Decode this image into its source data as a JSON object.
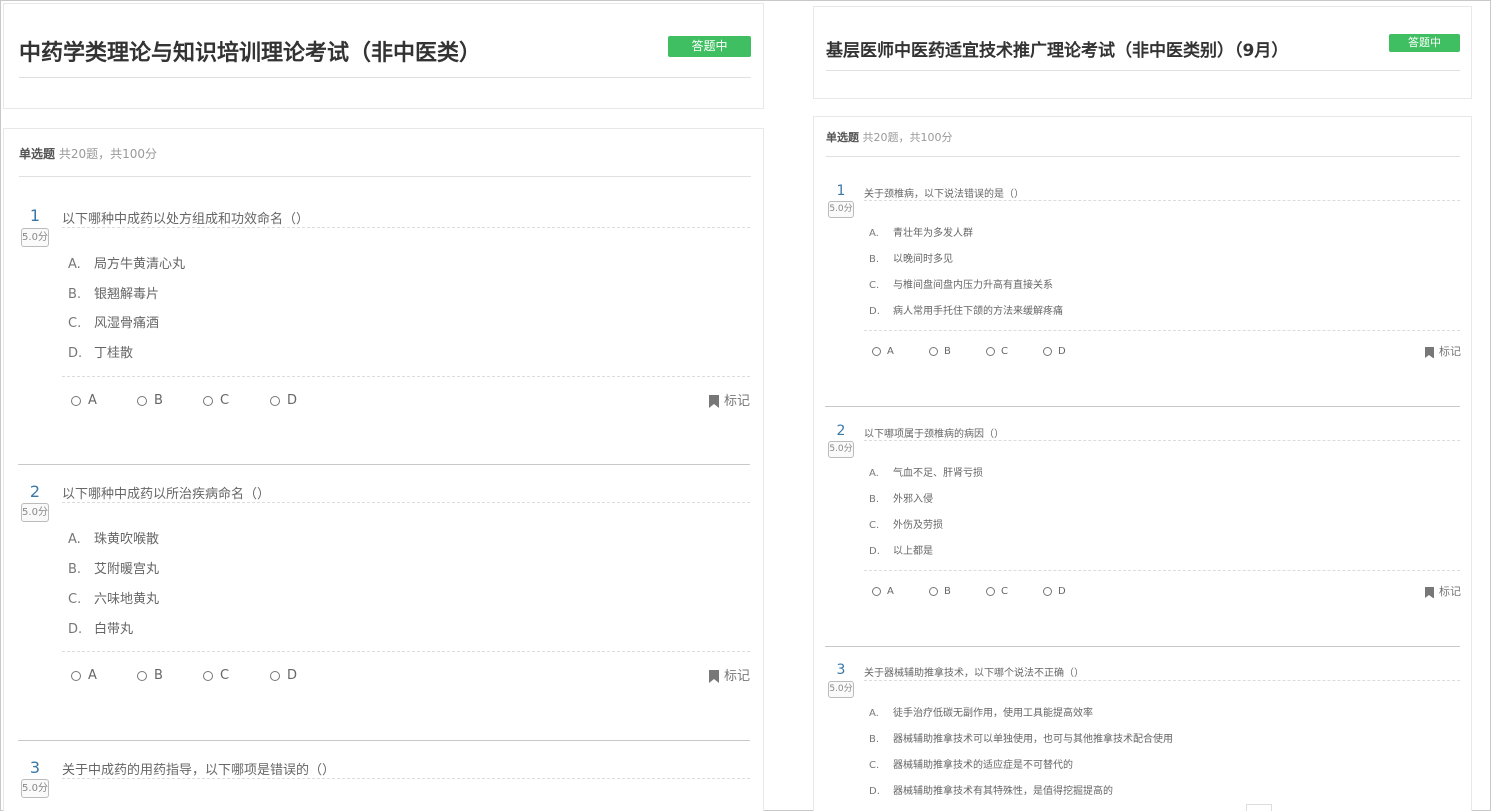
{
  "left": {
    "exam_title": "中药学类理论与知识培训理论考试（非中医类）",
    "status_badge": "答题中",
    "section": {
      "type": "单选题",
      "summary": "共20题，共100分"
    },
    "mark_label": "标记",
    "questions": [
      {
        "number": "1",
        "score": "5.0分",
        "text": "以下哪种中成药以处方组成和功效命名（）",
        "options": [
          {
            "letter": "A.",
            "text": "局方牛黄清心丸"
          },
          {
            "letter": "B.",
            "text": "银翘解毒片"
          },
          {
            "letter": "C.",
            "text": "风湿骨痛酒"
          },
          {
            "letter": "D.",
            "text": "丁桂散"
          }
        ],
        "choices": [
          "A",
          "B",
          "C",
          "D"
        ]
      },
      {
        "number": "2",
        "score": "5.0分",
        "text": "以下哪种中成药以所治疾病命名（）",
        "options": [
          {
            "letter": "A.",
            "text": "珠黄吹喉散"
          },
          {
            "letter": "B.",
            "text": "艾附暖宫丸"
          },
          {
            "letter": "C.",
            "text": "六味地黄丸"
          },
          {
            "letter": "D.",
            "text": "白带丸"
          }
        ],
        "choices": [
          "A",
          "B",
          "C",
          "D"
        ]
      },
      {
        "number": "3",
        "score": "5.0分",
        "text": "关于中成药的用药指导，以下哪项是错误的（）"
      }
    ]
  },
  "right": {
    "exam_title": "基层医师中医药适宜技术推广理论考试（非中医类别）（9月）",
    "status_badge": "答题中",
    "section": {
      "type": "单选题",
      "summary": "共20题，共100分"
    },
    "mark_label": "标记",
    "questions": [
      {
        "number": "1",
        "score": "5.0分",
        "text": "关于颈椎病，以下说法错误的是（）",
        "options": [
          {
            "letter": "A.",
            "text": "青壮年为多发人群"
          },
          {
            "letter": "B.",
            "text": "以晚间时多见"
          },
          {
            "letter": "C.",
            "text": "与椎间盘间盘内压力升高有直接关系"
          },
          {
            "letter": "D.",
            "text": "病人常用手托住下颌的方法来缓解疼痛"
          }
        ],
        "choices": [
          "A",
          "B",
          "C",
          "D"
        ]
      },
      {
        "number": "2",
        "score": "5.0分",
        "text": "以下哪项属于颈椎病的病因（）",
        "options": [
          {
            "letter": "A.",
            "text": "气血不足、肝肾亏损"
          },
          {
            "letter": "B.",
            "text": "外邪入侵"
          },
          {
            "letter": "C.",
            "text": "外伤及劳损"
          },
          {
            "letter": "D.",
            "text": "以上都是"
          }
        ],
        "choices": [
          "A",
          "B",
          "C",
          "D"
        ]
      },
      {
        "number": "3",
        "score": "5.0分",
        "text": "关于器械辅助推拿技术，以下哪个说法不正确（）",
        "options": [
          {
            "letter": "A.",
            "text": "徒手治疗低碳无副作用，使用工具能提高效率"
          },
          {
            "letter": "B.",
            "text": "器械辅助推拿技术可以单独使用，也可与其他推拿技术配合使用"
          },
          {
            "letter": "C.",
            "text": "器械辅助推拿技术的适应症是不可替代的"
          },
          {
            "letter": "D.",
            "text": "器械辅助推拿技术有其特殊性，是值得挖掘提高的"
          }
        ]
      }
    ]
  }
}
